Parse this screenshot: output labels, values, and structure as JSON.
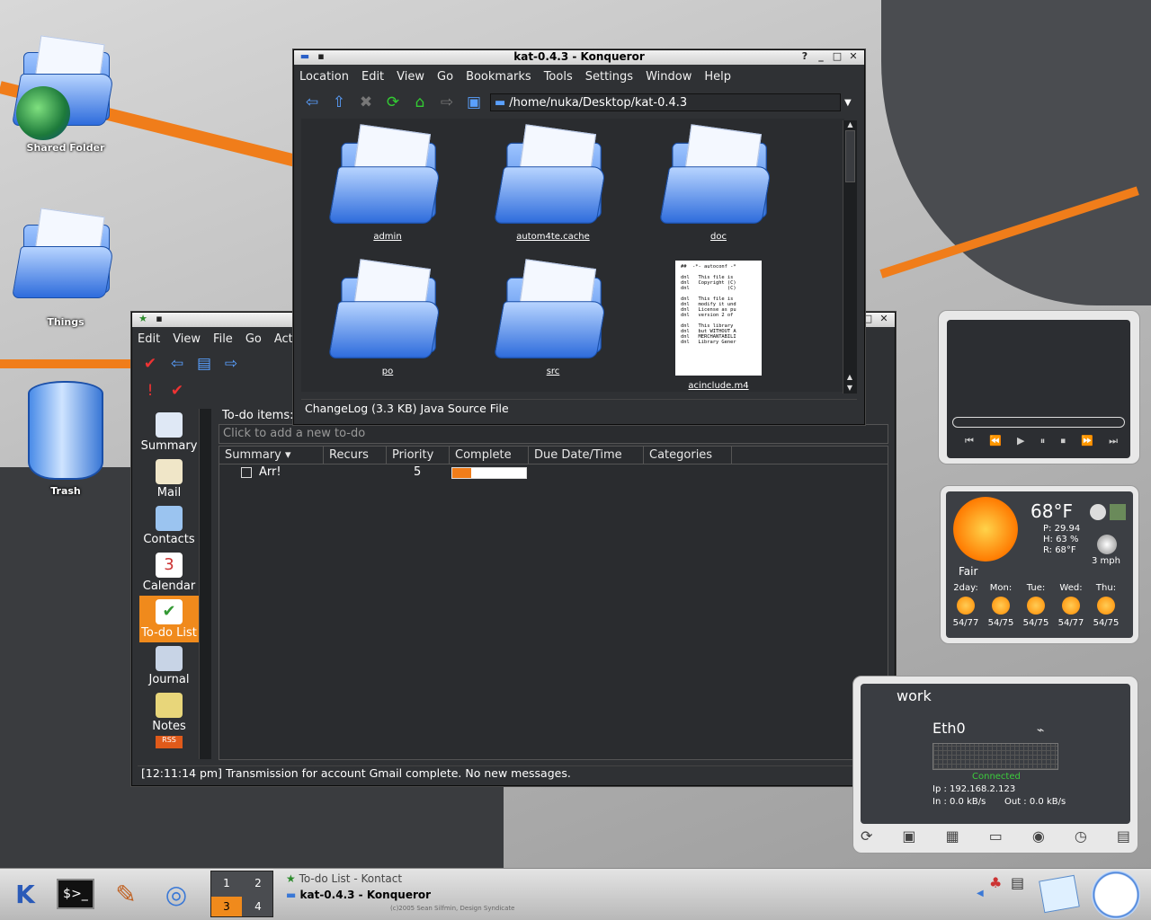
{
  "desktop": {
    "icons": [
      {
        "label": "Shared Folder"
      },
      {
        "label": "Things"
      },
      {
        "label": "Trash"
      }
    ]
  },
  "konqueror": {
    "title": "kat-0.4.3 - Konqueror",
    "menu": [
      "Location",
      "Edit",
      "View",
      "Go",
      "Bookmarks",
      "Tools",
      "Settings",
      "Window",
      "Help"
    ],
    "toolbar_icons": [
      "back-icon",
      "up-icon",
      "stop-icon",
      "reload-icon",
      "home-icon",
      "forward-icon",
      "location-icon",
      "folder-icon"
    ],
    "url": "/home/nuka/Desktop/kat-0.4.3",
    "items": [
      {
        "name": "admin",
        "type": "folder"
      },
      {
        "name": "autom4te.cache",
        "type": "folder"
      },
      {
        "name": "doc",
        "type": "folder"
      },
      {
        "name": "po",
        "type": "folder"
      },
      {
        "name": "src",
        "type": "folder"
      },
      {
        "name": "acinclude.m4",
        "type": "file"
      }
    ],
    "file_preview": [
      "##  -*- autoconf -*",
      "",
      "dnl   This file is",
      "dnl   Copyright (C)",
      "dnl             (C)",
      "",
      "dnl   This file is",
      "dnl   modify it und",
      "dnl   License as pu",
      "dnl   version 2 of",
      "",
      "dnl   This library",
      "dnl   but WITHOUT A",
      "dnl   MERCHANTABILI",
      "dnl   Library Gener"
    ],
    "status": "ChangeLog (3.3 KB)  Java Source File"
  },
  "kontact": {
    "title": "To-do List - Kontact",
    "menu": [
      "Edit",
      "View",
      "File",
      "Go",
      "Act"
    ],
    "sidebar": [
      {
        "label": "Summary"
      },
      {
        "label": "Mail"
      },
      {
        "label": "Contacts"
      },
      {
        "label": "Calendar"
      },
      {
        "label": "To-do List",
        "active": true
      },
      {
        "label": "Journal"
      },
      {
        "label": "Notes"
      }
    ],
    "todo_header": "To-do items:",
    "add_placeholder": "Click to add a new to-do",
    "columns": [
      "Summary",
      "Recurs",
      "Priority",
      "Complete",
      "Due Date/Time",
      "Categories"
    ],
    "rows": [
      {
        "summary": "Arr!",
        "recurs": "",
        "priority": "5",
        "complete": 0.25,
        "due": "",
        "categories": ""
      }
    ],
    "status": "[12:11:14 pm] Transmission for account Gmail complete. No new messages."
  },
  "weather": {
    "temp": "68°F",
    "pressure": "P:  29.94",
    "humidity": "H:  63 %",
    "realfeel": "R:  68°F",
    "wind": "3 mph",
    "condition": "Fair",
    "days": [
      {
        "name": "2day:",
        "range": "54/77"
      },
      {
        "name": "Mon:",
        "range": "54/75"
      },
      {
        "name": "Tue:",
        "range": "54/75"
      },
      {
        "name": "Wed:",
        "range": "54/77"
      },
      {
        "name": "Thu:",
        "range": "54/75"
      }
    ]
  },
  "network": {
    "title": "work",
    "iface": "Eth0",
    "state": "Connected",
    "ip": "Ip : 192.168.2.123",
    "in": "In : 0.0 kB/s",
    "out": "Out : 0.0 kB/s"
  },
  "taskbar": {
    "desktops": [
      "1",
      "2",
      "3",
      "4"
    ],
    "tasks": [
      "To-do List - Kontact",
      "kat-0.4.3 - Konqueror"
    ],
    "credit": "(c)2005 Sean Silfmin, Design Syndicate"
  },
  "colors": {
    "accent": "#f07d1a",
    "window_bg": "#2f3134",
    "selected": "#f08a1c"
  }
}
